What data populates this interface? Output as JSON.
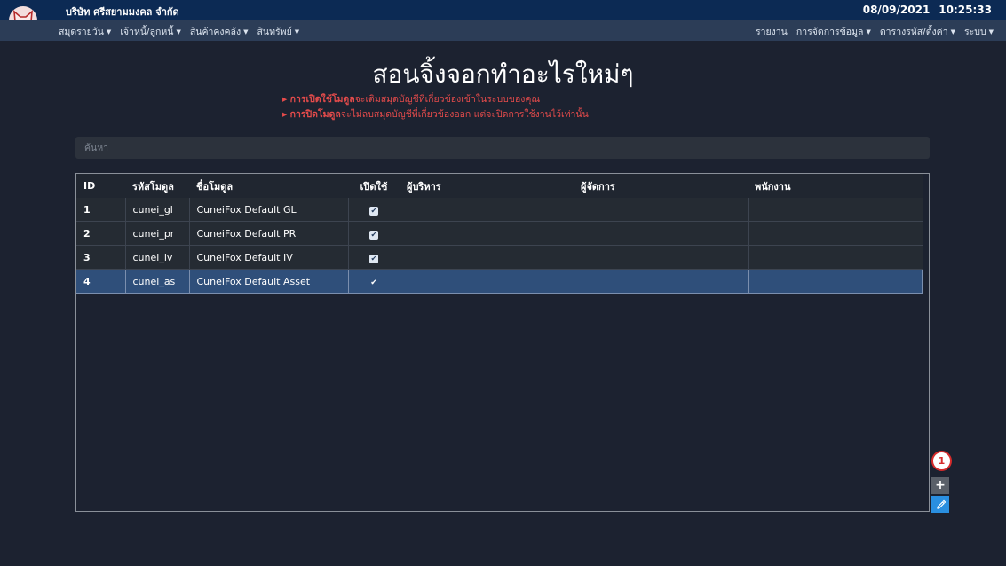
{
  "header": {
    "company": "บริษัท ศรีสยามมงคล จำกัด",
    "date": "08/09/2021",
    "time": "10:25:33"
  },
  "menu": {
    "left": [
      "สมุดรายวัน",
      "เจ้าหนี้/ลูกหนี้",
      "สินค้าคงคลัง",
      "สินทรัพย์"
    ],
    "right": [
      "รายงาน",
      "การจัดการข้อมูล",
      "ตารางรหัส/ตั้งค่า",
      "ระบบ"
    ]
  },
  "page": {
    "title": "สอนจิ้งจอกทำอะไรใหม่ๆ",
    "note1_bold": "การเปิดใช้โมดูล",
    "note1_rest": "จะเติมสมุดบัญชีที่เกี่ยวข้องเข้าในระบบของคุณ",
    "note2_bold": "การปิดโมดูล",
    "note2_rest": "จะไม่ลบสมุดบัญชีที่เกี่ยวข้องออก แต่จะปิดการใช้งานไว้เท่านั้น"
  },
  "search": {
    "placeholder": "ค้นหา"
  },
  "table": {
    "headers": [
      "ID",
      "รหัสโมดูล",
      "ชื่อโมดูล",
      "เปิดใช้",
      "ผู้บริหาร",
      "ผู้จัดการ",
      "พนักงาน"
    ],
    "rows": [
      {
        "id": "1",
        "code": "cunei_gl",
        "name": "CuneiFox Default GL",
        "enabled": "✔"
      },
      {
        "id": "2",
        "code": "cunei_pr",
        "name": "CuneiFox Default PR",
        "enabled": "✔"
      },
      {
        "id": "3",
        "code": "cunei_iv",
        "name": "CuneiFox Default IV",
        "enabled": "✔"
      },
      {
        "id": "4",
        "code": "cunei_as",
        "name": "CuneiFox Default Asset",
        "enabled": "✔"
      }
    ]
  },
  "actions": {
    "badge": "1",
    "add_icon": "plus-icon",
    "edit_icon": "pencil-icon"
  }
}
